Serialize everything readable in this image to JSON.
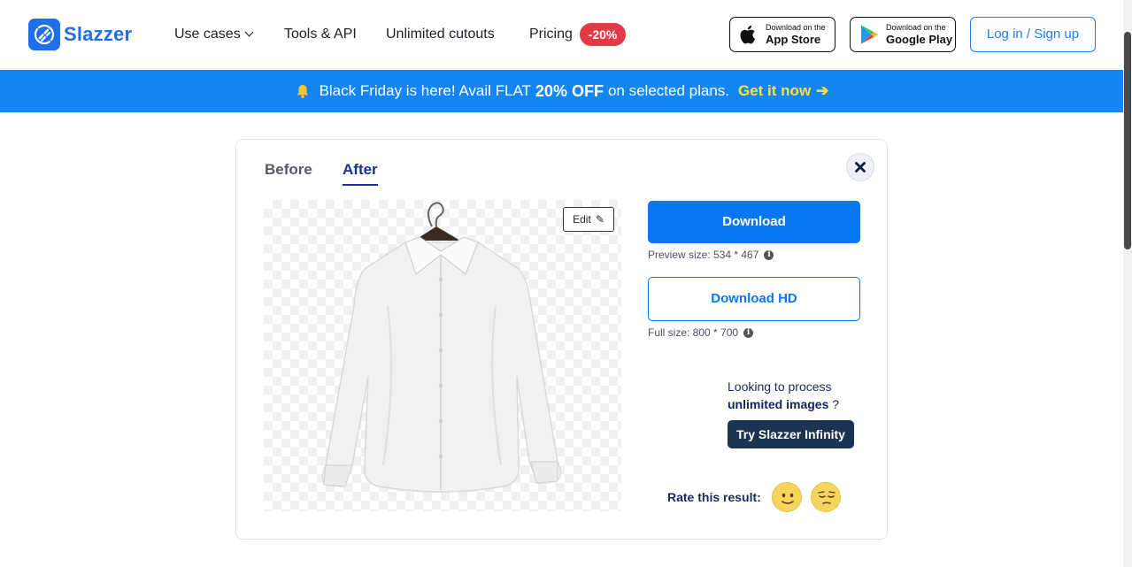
{
  "header": {
    "brand": "Slazzer",
    "nav": {
      "use_cases": "Use cases",
      "tools_api": "Tools & API",
      "unlimited_cutouts": "Unlimited cutouts",
      "pricing": "Pricing",
      "pricing_badge": "-20%"
    },
    "app_store": {
      "small": "Download on the",
      "big": "App Store"
    },
    "google_play": {
      "small": "Download on the",
      "big": "Google Play"
    },
    "login": "Log in / Sign up"
  },
  "promo": {
    "text_before": "Black Friday is here! Avail FLAT",
    "highlight": "20% OFF",
    "text_after": "on selected plans.",
    "cta": "Get it now"
  },
  "result_card": {
    "tabs": {
      "before": "Before",
      "after": "After",
      "active": "After"
    },
    "edit_label": "Edit",
    "download_label": "Download",
    "preview_size": "Preview size: 534 * 467",
    "download_hd_label": "Download HD",
    "full_size": "Full size: 800 * 700",
    "unlimited": {
      "line1": "Looking to process",
      "strong": "unlimited images",
      "suffix": "?"
    },
    "infinity_label": "Try Slazzer Infinity",
    "rate_label": "Rate this result:"
  },
  "colors": {
    "brand_blue": "#1f6fe8",
    "promo_bg": "#1385f5",
    "cta_yellow": "#ffe033",
    "badge_red": "#e53945",
    "download_blue": "#0a77f2",
    "navy_button": "#1d3352"
  },
  "icons": [
    "logo-icon",
    "chevron-down-icon",
    "apple-icon",
    "google-play-icon",
    "bell-icon",
    "arrow-right-icon",
    "close-icon",
    "pencil-icon",
    "info-icon",
    "happy-face-icon",
    "meh-face-icon"
  ]
}
